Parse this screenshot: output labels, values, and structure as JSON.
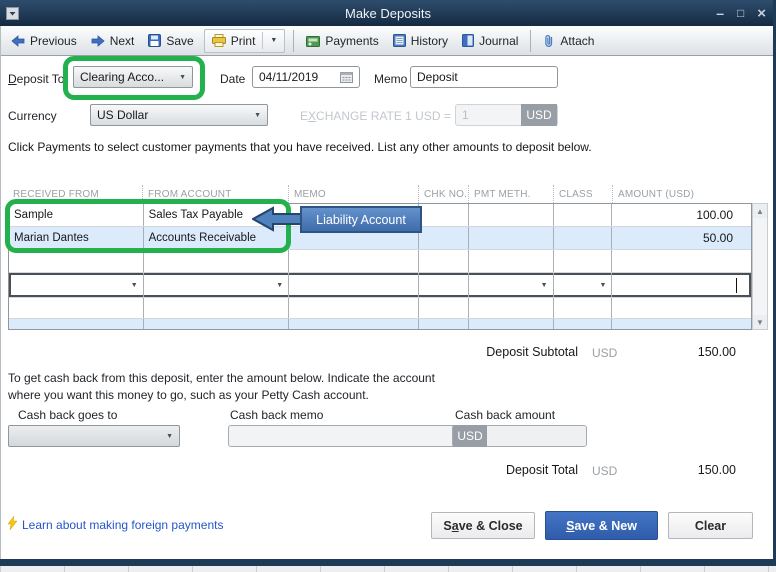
{
  "window": {
    "title": "Make Deposits",
    "controls": {
      "minimize": "–",
      "maximize": "□",
      "close": "×"
    }
  },
  "icons": {
    "dropdown": "▼",
    "scroll_up": "▲",
    "scroll_down": "▼"
  },
  "colors": {
    "highlight_green": "#22b14c",
    "callout_blue": "#4f81bd",
    "primary_button_blue": "#2f5cab",
    "row_highlight_blue": "#dcebfb",
    "titlebar_navy": "#1d3a57",
    "link_blue": "#2456c9"
  },
  "toolbar": {
    "items": [
      {
        "label": "Previous",
        "icon": "arrow-left-icon"
      },
      {
        "label": "Next",
        "icon": "arrow-right-icon"
      },
      {
        "label": "Save",
        "icon": "save-icon"
      },
      {
        "label": "Print",
        "icon": "print-icon"
      },
      {
        "label": "Payments",
        "icon": "payments-icon"
      },
      {
        "label": "History",
        "icon": "history-icon"
      },
      {
        "label": "Journal",
        "icon": "journal-icon"
      },
      {
        "label": "Attach",
        "icon": "attach-icon"
      }
    ]
  },
  "form": {
    "deposit_to": {
      "label_u": "D",
      "label_rest": "eposit To",
      "value": "Clearing Acco..."
    },
    "date": {
      "label": "Date",
      "value": "04/11/2019"
    },
    "memo": {
      "label": "Memo",
      "value": "Deposit"
    },
    "currency": {
      "label": "Currency",
      "value": "US Dollar"
    },
    "exchange_rate": {
      "label_p1": "E",
      "label_u": "X",
      "label_p2": "CHANGE RATE 1 USD =",
      "value": "1",
      "unit": "USD"
    }
  },
  "instruction": "Click Payments to select customer payments that you have received. List any other amounts to deposit below.",
  "table": {
    "columns": [
      "RECEIVED FROM",
      "FROM ACCOUNT",
      "MEMO",
      "CHK NO.",
      "PMT METH.",
      "CLASS",
      "AMOUNT (USD)"
    ],
    "rows": [
      {
        "received_from": "Sample",
        "from_account": "Sales Tax Payable",
        "memo": "",
        "chk_no": "",
        "pmt_meth": "",
        "class": "",
        "amount": "100.00"
      },
      {
        "received_from": "Marian Dantes",
        "from_account": "Accounts Receivable",
        "memo": "",
        "chk_no": "",
        "pmt_meth": "",
        "class": "",
        "amount": "50.00"
      }
    ]
  },
  "callout": {
    "label": "Liability Account"
  },
  "deposit_subtotal": {
    "label": "Deposit Subtotal",
    "currency": "USD",
    "value": "150.00"
  },
  "cash_back": {
    "instruction_line1": "To get cash back from this deposit, enter the amount below.  Indicate the account",
    "instruction_line2": "where you want this money to go, such as your Petty Cash account.",
    "goes_to_label": "Cash back goes to",
    "memo_label": "Cash back memo",
    "amount_label": "Cash back amount",
    "amount_unit": "USD"
  },
  "deposit_total": {
    "label": "Deposit Total",
    "currency": "USD",
    "value": "150.00"
  },
  "footer": {
    "link": "Learn about making foreign payments",
    "save_close": {
      "p1": "S",
      "u": "a",
      "p2": "ve & Close"
    },
    "save_new": {
      "p1": "",
      "u": "S",
      "p2": "ave & New"
    },
    "clear": {
      "label": "Clear"
    }
  }
}
